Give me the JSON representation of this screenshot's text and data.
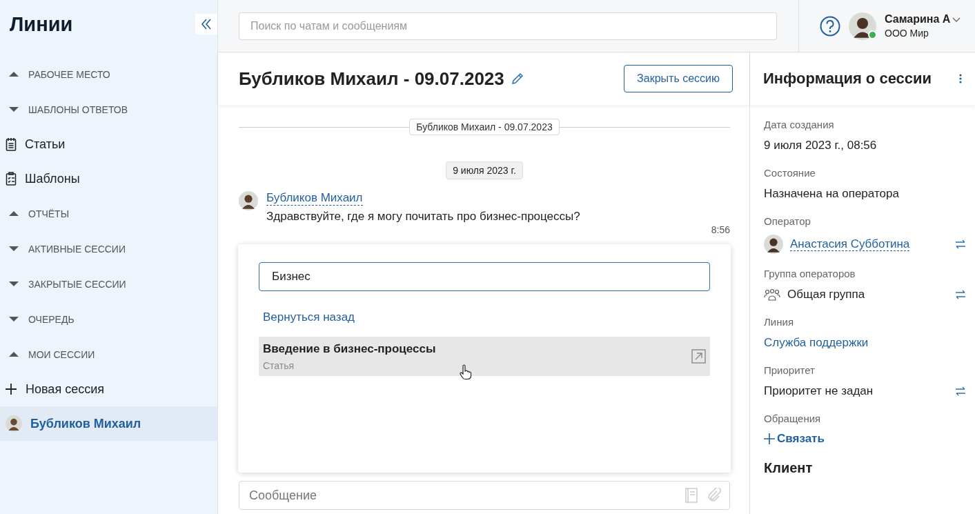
{
  "sidebar": {
    "title": "Линии",
    "items": [
      {
        "kind": "section",
        "label": "РАБОЧЕЕ МЕСТО",
        "expanded": false
      },
      {
        "kind": "section",
        "label": "ШАБЛОНЫ ОТВЕТОВ",
        "expanded": true
      },
      {
        "kind": "articles",
        "label": "Статьи",
        "selected": false
      },
      {
        "kind": "templates",
        "label": "Шаблоны",
        "selected": false
      },
      {
        "kind": "section",
        "label": "ОТЧЁТЫ",
        "expanded": false
      },
      {
        "kind": "section",
        "label": "АКТИВНЫЕ СЕССИИ",
        "expanded": true
      },
      {
        "kind": "section",
        "label": "ЗАКРЫТЫЕ СЕССИИ",
        "expanded": true
      },
      {
        "kind": "section",
        "label": "ОЧЕРЕДЬ",
        "expanded": true
      },
      {
        "kind": "section",
        "label": "МОИ СЕССИИ",
        "expanded": false
      },
      {
        "kind": "new",
        "label": "Новая сессия",
        "selected": false
      },
      {
        "kind": "session",
        "label": "Бубликов Михаил",
        "selected": true
      }
    ]
  },
  "topbar": {
    "search": {
      "placeholder": "Поиск по чатам и сообщениям"
    },
    "user": {
      "name": "Самарина А",
      "company": "ООО Мир",
      "online": true
    }
  },
  "chat": {
    "title": "Бубликов Михаил - 09.07.2023",
    "close_button": "Закрыть сессию",
    "session_divider": "Бубликов Михаил - 09.07.2023",
    "date_badge": "9 июля 2023 г.",
    "messages": [
      {
        "author": "Бубликов Михаил",
        "text": "Здравствуйте, где я могу почитать про бизнес-процессы?",
        "time": "8:56"
      }
    ],
    "popup": {
      "search_value": "Бизнес",
      "back_link": "Вернуться назад",
      "results": [
        {
          "title": "Введение в бизнес-процессы",
          "type": "Статья",
          "highlighted": true
        }
      ]
    },
    "composer": {
      "placeholder": "Сообщение"
    }
  },
  "session_info": {
    "title": "Информация о сессии",
    "fields": [
      {
        "kind": "text",
        "label": "Дата создания",
        "value": "9 июля 2023 г., 08:56",
        "swap": false
      },
      {
        "kind": "text",
        "label": "Состояние",
        "value": "Назначена на оператора",
        "swap": false
      },
      {
        "kind": "person",
        "label": "Оператор",
        "value": "Анастасия Субботина",
        "swap": true
      },
      {
        "kind": "group",
        "label": "Группа операторов",
        "value": "Общая группа",
        "swap": true
      },
      {
        "kind": "link",
        "label": "Линия",
        "value": "Служба поддержки",
        "swap": false
      },
      {
        "kind": "text",
        "label": "Приоритет",
        "value": "Приоритет не задан",
        "swap": true
      },
      {
        "kind": "action",
        "label": "Обращения",
        "value": "Связать",
        "swap": false
      }
    ],
    "client_heading": "Клиент"
  }
}
